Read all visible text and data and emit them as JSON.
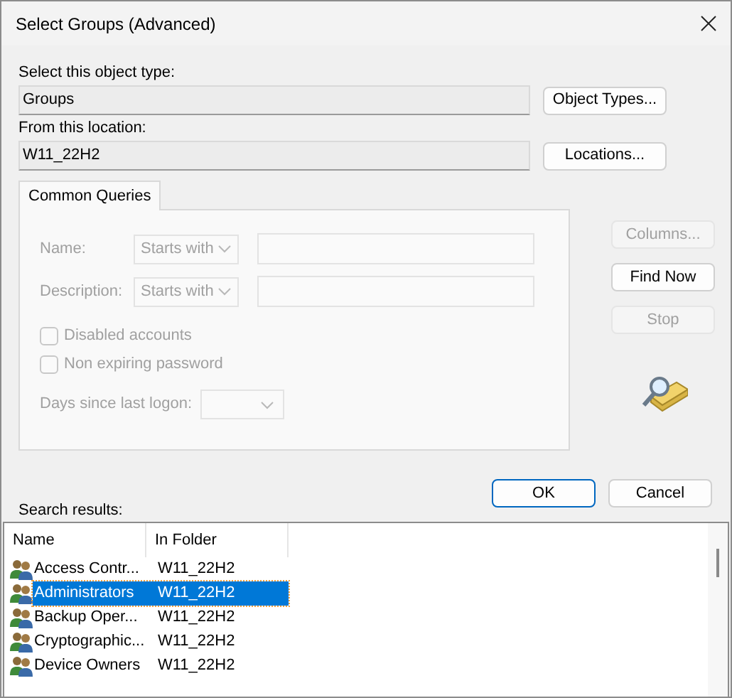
{
  "window": {
    "title": "Select Groups (Advanced)"
  },
  "object_type": {
    "label": "Select this object type:",
    "value": "Groups",
    "button": "Object Types..."
  },
  "location": {
    "label": "From this location:",
    "value": "W11_22H2",
    "button": "Locations..."
  },
  "tabs": [
    {
      "label": "Common Queries",
      "selected": true
    }
  ],
  "queries": [
    {
      "label": "Name:",
      "mode": "Starts with",
      "disabled": true
    },
    {
      "label": "Description:",
      "mode": "Starts with",
      "disabled": true
    }
  ],
  "options": [
    {
      "label": "Disabled accounts",
      "checked": false,
      "disabled": true
    },
    {
      "label": "Non expiring password",
      "checked": false,
      "disabled": true
    }
  ],
  "days_since_logon": {
    "label": "Days since last logon:",
    "disabled": true
  },
  "side_buttons": [
    {
      "label": "Columns...",
      "disabled": true
    },
    {
      "label": "Find Now",
      "disabled": false
    },
    {
      "label": "Stop",
      "disabled": true
    }
  ],
  "dialog_buttons": [
    {
      "label": "OK",
      "default": true
    },
    {
      "label": "Cancel",
      "default": false
    }
  ],
  "results": {
    "label": "Search results:",
    "columns": [
      "Name",
      "In Folder"
    ],
    "rows": [
      {
        "name": "Access Contr...",
        "folder": "W11_22H2",
        "selected": false
      },
      {
        "name": "Administrators",
        "folder": "W11_22H2",
        "selected": true
      },
      {
        "name": "Backup Oper...",
        "folder": "W11_22H2",
        "selected": false
      },
      {
        "name": "Cryptographic...",
        "folder": "W11_22H2",
        "selected": false
      },
      {
        "name": "Device Owners",
        "folder": "W11_22H2",
        "selected": false
      }
    ]
  }
}
